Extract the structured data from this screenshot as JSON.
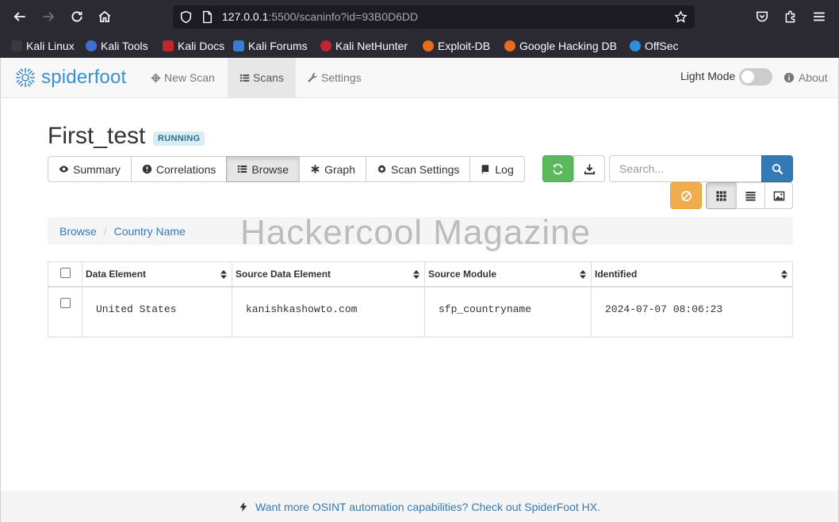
{
  "browser": {
    "url_host": "127.0.0.1",
    "url_rest": ":5500/scaninfo?id=93B0D6DD",
    "bookmarks": [
      {
        "label": "Kali Linux",
        "color": "#3a3a3a"
      },
      {
        "label": "Kali Tools",
        "color": "#3f6fd1"
      },
      {
        "label": "Kali Docs",
        "color": "#c0272d"
      },
      {
        "label": "Kali Forums",
        "color": "#3a7bd5"
      },
      {
        "label": "Kali NetHunter",
        "color": "#c0272d"
      },
      {
        "label": "Exploit-DB",
        "color": "#e86c1a"
      },
      {
        "label": "Google Hacking DB",
        "color": "#e86c1a"
      },
      {
        "label": "OffSec",
        "color": "#2d8fd9"
      }
    ]
  },
  "navbar": {
    "brand": "spiderfoot",
    "items": [
      {
        "label": "New Scan",
        "icon": "crosshair-icon"
      },
      {
        "label": "Scans",
        "icon": "list-icon"
      },
      {
        "label": "Settings",
        "icon": "wrench-icon"
      }
    ],
    "light_mode_label": "Light Mode",
    "about_label": "About"
  },
  "scan": {
    "name": "First_test",
    "status": "RUNNING",
    "tabs": [
      {
        "label": "Summary",
        "icon": "eye-icon"
      },
      {
        "label": "Correlations",
        "icon": "exclamation-circle-icon"
      },
      {
        "label": "Browse",
        "icon": "list-icon"
      },
      {
        "label": "Graph",
        "icon": "asterisk-icon"
      },
      {
        "label": "Scan Settings",
        "icon": "gear-icon"
      },
      {
        "label": "Log",
        "icon": "book-icon"
      }
    ],
    "active_tab": "Browse",
    "search_placeholder": "Search..."
  },
  "breadcrumb": {
    "root": "Browse",
    "current": "Country Name"
  },
  "watermark": "Hackercool Magazine",
  "table": {
    "headers": [
      "Data Element",
      "Source Data Element",
      "Source Module",
      "Identified"
    ],
    "rows": [
      {
        "data_element": "United States",
        "source_data_element": "kanishkashowto.com",
        "source_module": "sfp_countryname",
        "identified": "2024-07-07 08:06:23"
      }
    ]
  },
  "footer": {
    "text": "Want more OSINT automation capabilities? Check out SpiderFoot HX."
  },
  "colors": {
    "brand": "#3a8fcf",
    "link": "#337ab7",
    "success": "#5cb85c",
    "warning": "#f0ad4e",
    "primary": "#337ab7",
    "badge_bg": "#d9edf7"
  }
}
